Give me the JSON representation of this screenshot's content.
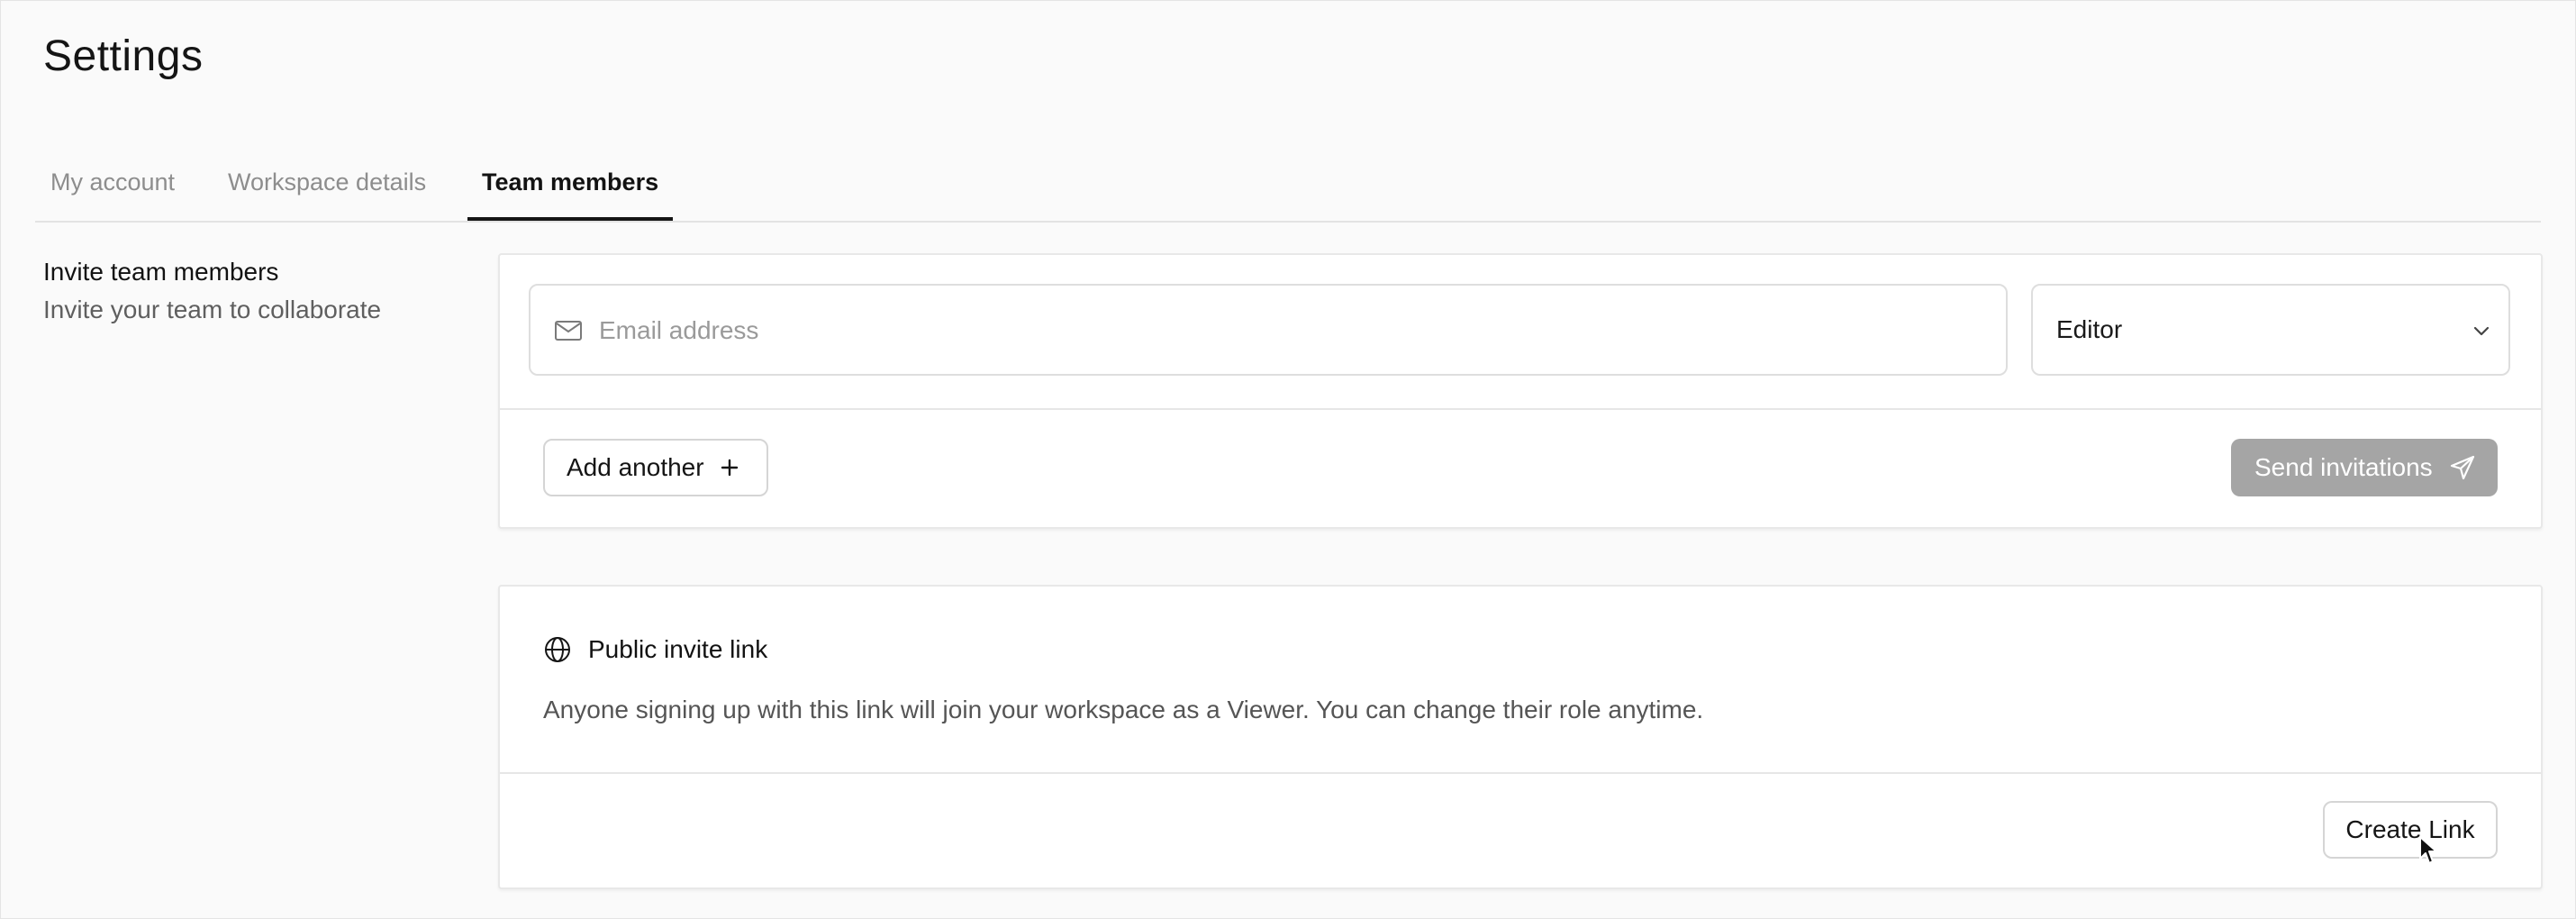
{
  "page": {
    "title": "Settings"
  },
  "tabs": [
    {
      "label": "My account",
      "active": false
    },
    {
      "label": "Workspace details",
      "active": false
    },
    {
      "label": "Team members",
      "active": true
    }
  ],
  "invite_section": {
    "title": "Invite team members",
    "description": "Invite your team to collaborate",
    "email_placeholder": "Email address",
    "email_value": "",
    "email_icon": "mail-icon",
    "role_selected": "Editor",
    "role_icon": "chevron-down-icon",
    "add_another_label": "Add another",
    "add_another_icon": "plus-icon",
    "send_label": "Send invitations",
    "send_icon": "send-icon",
    "send_disabled": true
  },
  "public_link": {
    "icon": "globe-icon",
    "title": "Public invite link",
    "description": "Anyone signing up with this link will join your workspace as a Viewer. You can change their role anytime.",
    "create_label": "Create Link"
  },
  "colors": {
    "background": "#fafafa",
    "card": "#ffffff",
    "active_tab_text": "#121212",
    "inactive_tab_text": "#8d8d8d",
    "send_button_disabled": "#a5a5a5",
    "border": "#dedede"
  }
}
